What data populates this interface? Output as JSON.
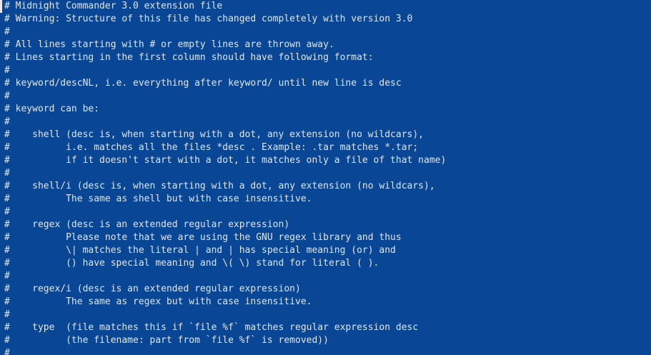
{
  "editor": {
    "background": "#0a4696",
    "text_color": "#e2e6ec",
    "lines": [
      "# Midnight Commander 3.0 extension file",
      "# Warning: Structure of this file has changed completely with version 3.0",
      "#",
      "# All lines starting with # or empty lines are thrown away.",
      "# Lines starting in the first column should have following format:",
      "#",
      "# keyword/descNL, i.e. everything after keyword/ until new line is desc",
      "#",
      "# keyword can be:",
      "#",
      "#    shell (desc is, when starting with a dot, any extension (no wildcars),",
      "#          i.e. matches all the files *desc . Example: .tar matches *.tar;",
      "#          if it doesn't start with a dot, it matches only a file of that name)",
      "#",
      "#    shell/i (desc is, when starting with a dot, any extension (no wildcars),",
      "#          The same as shell but with case insensitive.",
      "#",
      "#    regex (desc is an extended regular expression)",
      "#          Please note that we are using the GNU regex library and thus",
      "#          \\| matches the literal | and | has special meaning (or) and",
      "#          () have special meaning and \\( \\) stand for literal ( ).",
      "#",
      "#    regex/i (desc is an extended regular expression)",
      "#          The same as regex but with case insensitive.",
      "#",
      "#    type  (file matches this if `file %f` matches regular expression desc",
      "#          (the filename: part from `file %f` is removed))",
      "#"
    ]
  }
}
